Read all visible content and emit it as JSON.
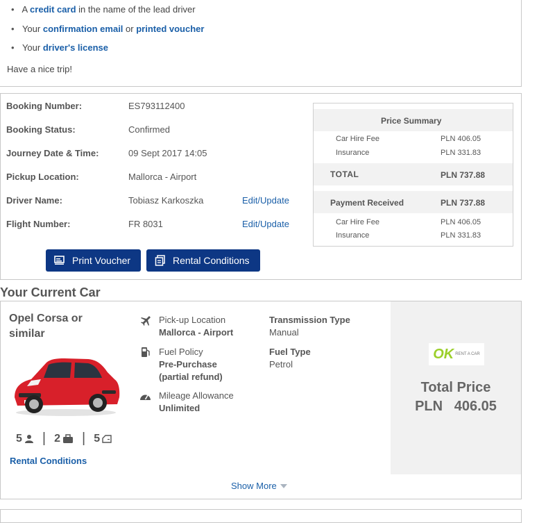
{
  "requirements": {
    "items": [
      {
        "prefix": "A ",
        "link": "credit card",
        "suffix": " in the name of the lead driver"
      },
      {
        "prefix": "Your ",
        "link": "confirmation email",
        "middle": " or ",
        "link2": "printed voucher"
      },
      {
        "prefix": "Your ",
        "link": "driver's license"
      }
    ],
    "closing": "Have a nice trip!"
  },
  "booking": {
    "rows": [
      {
        "label": "Booking Number:",
        "value": "ES793112400"
      },
      {
        "label": "Booking Status:",
        "value": "Confirmed"
      },
      {
        "label": "Journey Date & Time:",
        "value": "09 Sept 2017 14:05"
      },
      {
        "label": "Pickup Location:",
        "value": "Mallorca - Airport"
      },
      {
        "label": "Driver Name:",
        "value": "Tobiasz Karkoszka",
        "action": "Edit/Update"
      },
      {
        "label": "Flight Number:",
        "value": "FR  8031",
        "action": "Edit/Update"
      }
    ],
    "print_voucher": "Print Voucher",
    "rental_conditions": "Rental Conditions"
  },
  "price_summary": {
    "title": "Price Summary",
    "items": [
      {
        "label": "Car Hire Fee",
        "value": "PLN 406.05"
      },
      {
        "label": "Insurance",
        "value": "PLN 331.83"
      }
    ],
    "total_label": "TOTAL",
    "total_value": "PLN 737.88",
    "payment_label": "Payment Received",
    "payment_value": "PLN 737.88",
    "payment_items": [
      {
        "label": "Car Hire Fee",
        "value": "PLN 406.05"
      },
      {
        "label": "Insurance",
        "value": "PLN 331.83"
      }
    ]
  },
  "current_car": {
    "heading": "Your Current Car",
    "name_line1": "Opel Corsa or",
    "name_line2": "similar",
    "seats": "5",
    "bags": "2",
    "doors": "5",
    "rental_conditions_link": "Rental Conditions",
    "pickup_label": "Pick-up Location",
    "pickup_value": "Mallorca - Airport",
    "fuel_policy_label": "Fuel Policy",
    "fuel_policy_value1": "Pre-Purchase",
    "fuel_policy_value2": "(partial refund)",
    "mileage_label": "Mileage Allowance",
    "mileage_value": "Unlimited",
    "transmission_label": "Transmission Type",
    "transmission_value": "Manual",
    "fuel_type_label": "Fuel Type",
    "fuel_type_value": "Petrol",
    "supplier_logo_text": "OK",
    "supplier_logo_subtext": "RENT A CAR",
    "total_price_label": "Total Price",
    "total_price_value": "PLN   406.05",
    "show_more": "Show More"
  },
  "colors": {
    "link": "#1a5fa8",
    "button": "#0d3784",
    "panel": "#f1f1f1",
    "car_red": "#d8202a",
    "logo_green": "#9bcf2a"
  }
}
